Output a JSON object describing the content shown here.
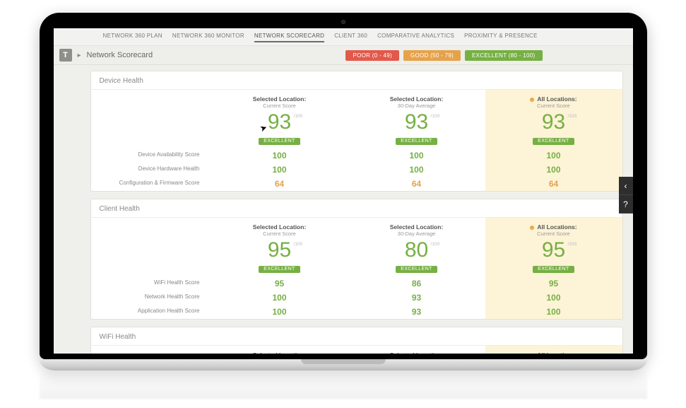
{
  "tabs": {
    "items": [
      {
        "label": "NETWORK 360 PLAN"
      },
      {
        "label": "NETWORK 360 MONITOR"
      },
      {
        "label": "NETWORK SCORECARD"
      },
      {
        "label": "CLIENT 360"
      },
      {
        "label": "COMPARATIVE ANALYTICS"
      },
      {
        "label": "PROXIMITY & PRESENCE"
      }
    ]
  },
  "titlebar": {
    "icon_letter": "T",
    "title": "Network Scorecard"
  },
  "legend": {
    "poor": "POOR (0 - 49)",
    "good": "GOOD (50 - 79)",
    "excellent": "EXCELLENT (80 - 100)"
  },
  "column_headers": {
    "c1_l1": "Selected Location:",
    "c1_l2": "Current Score",
    "c2_l1": "Selected Location:",
    "c2_l2": "30-Day Average",
    "c3_l1": "All Locations:",
    "c3_l2": "Current Score"
  },
  "of100": "/100",
  "badge_excellent": "EXCELLENT",
  "device": {
    "title": "Device Health",
    "scores": {
      "c1": "93",
      "c2": "93",
      "c3": "93"
    },
    "rows": [
      {
        "label": "Device Availability Score",
        "c1": "100",
        "c2": "100",
        "c3": "100",
        "cls": "m-green"
      },
      {
        "label": "Device Hardware Health",
        "c1": "100",
        "c2": "100",
        "c3": "100",
        "cls": "m-green"
      },
      {
        "label": "Configuration & Firmware Score",
        "c1": "64",
        "c2": "64",
        "c3": "64",
        "cls": "m-orange"
      }
    ]
  },
  "client": {
    "title": "Client Health",
    "scores": {
      "c1": "95",
      "c2": "80",
      "c3": "95"
    },
    "rows": [
      {
        "label": "WiFi Health Score",
        "c1": "95",
        "c2": "86",
        "c3": "95",
        "cls": "m-green"
      },
      {
        "label": "Network Health Score",
        "c1": "100",
        "c2": "93",
        "c3": "100",
        "cls": "m-green"
      },
      {
        "label": "Application Health Score",
        "c1": "100",
        "c2": "93",
        "c3": "100",
        "cls": "m-green"
      }
    ]
  },
  "wifi": {
    "title": "WiFi Health"
  }
}
